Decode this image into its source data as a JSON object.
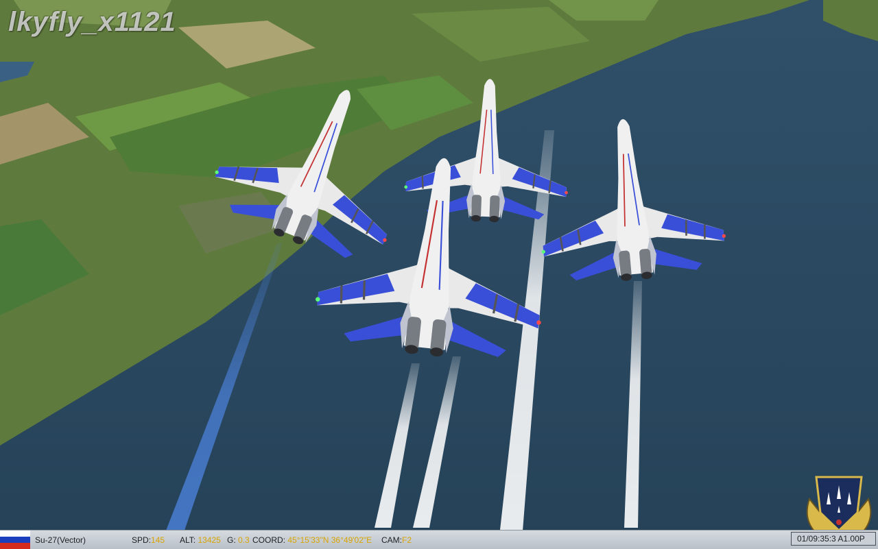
{
  "watermark": "lkyfly_x1121",
  "hud": {
    "aircraft": "Su-27(Vector)",
    "spd_label": "SPD:",
    "spd_value": "145",
    "alt_label": "ALT:",
    "alt_value": "13425",
    "g_label": "G:",
    "g_value": "0.3",
    "coord_label": "COORD:",
    "coord_lat": "45°15'33\"N",
    "coord_lon": "36°49'02\"E",
    "cam_label": "CAM:",
    "cam_value": "F2",
    "time": "01/09:35:3",
    "time_accel": "A1.00P"
  },
  "colors": {
    "sea": "#2e4d66",
    "land": "#5f7a3d",
    "aircraft_white": "#e9e9ea",
    "aircraft_blue": "#3a4fd8",
    "hud_value": "#d8a400",
    "emblem_gold": "#d9b94a",
    "emblem_navy": "#1b2d5c"
  },
  "icons": [
    "russian-flag-icon",
    "squadron-emblem-icon"
  ]
}
